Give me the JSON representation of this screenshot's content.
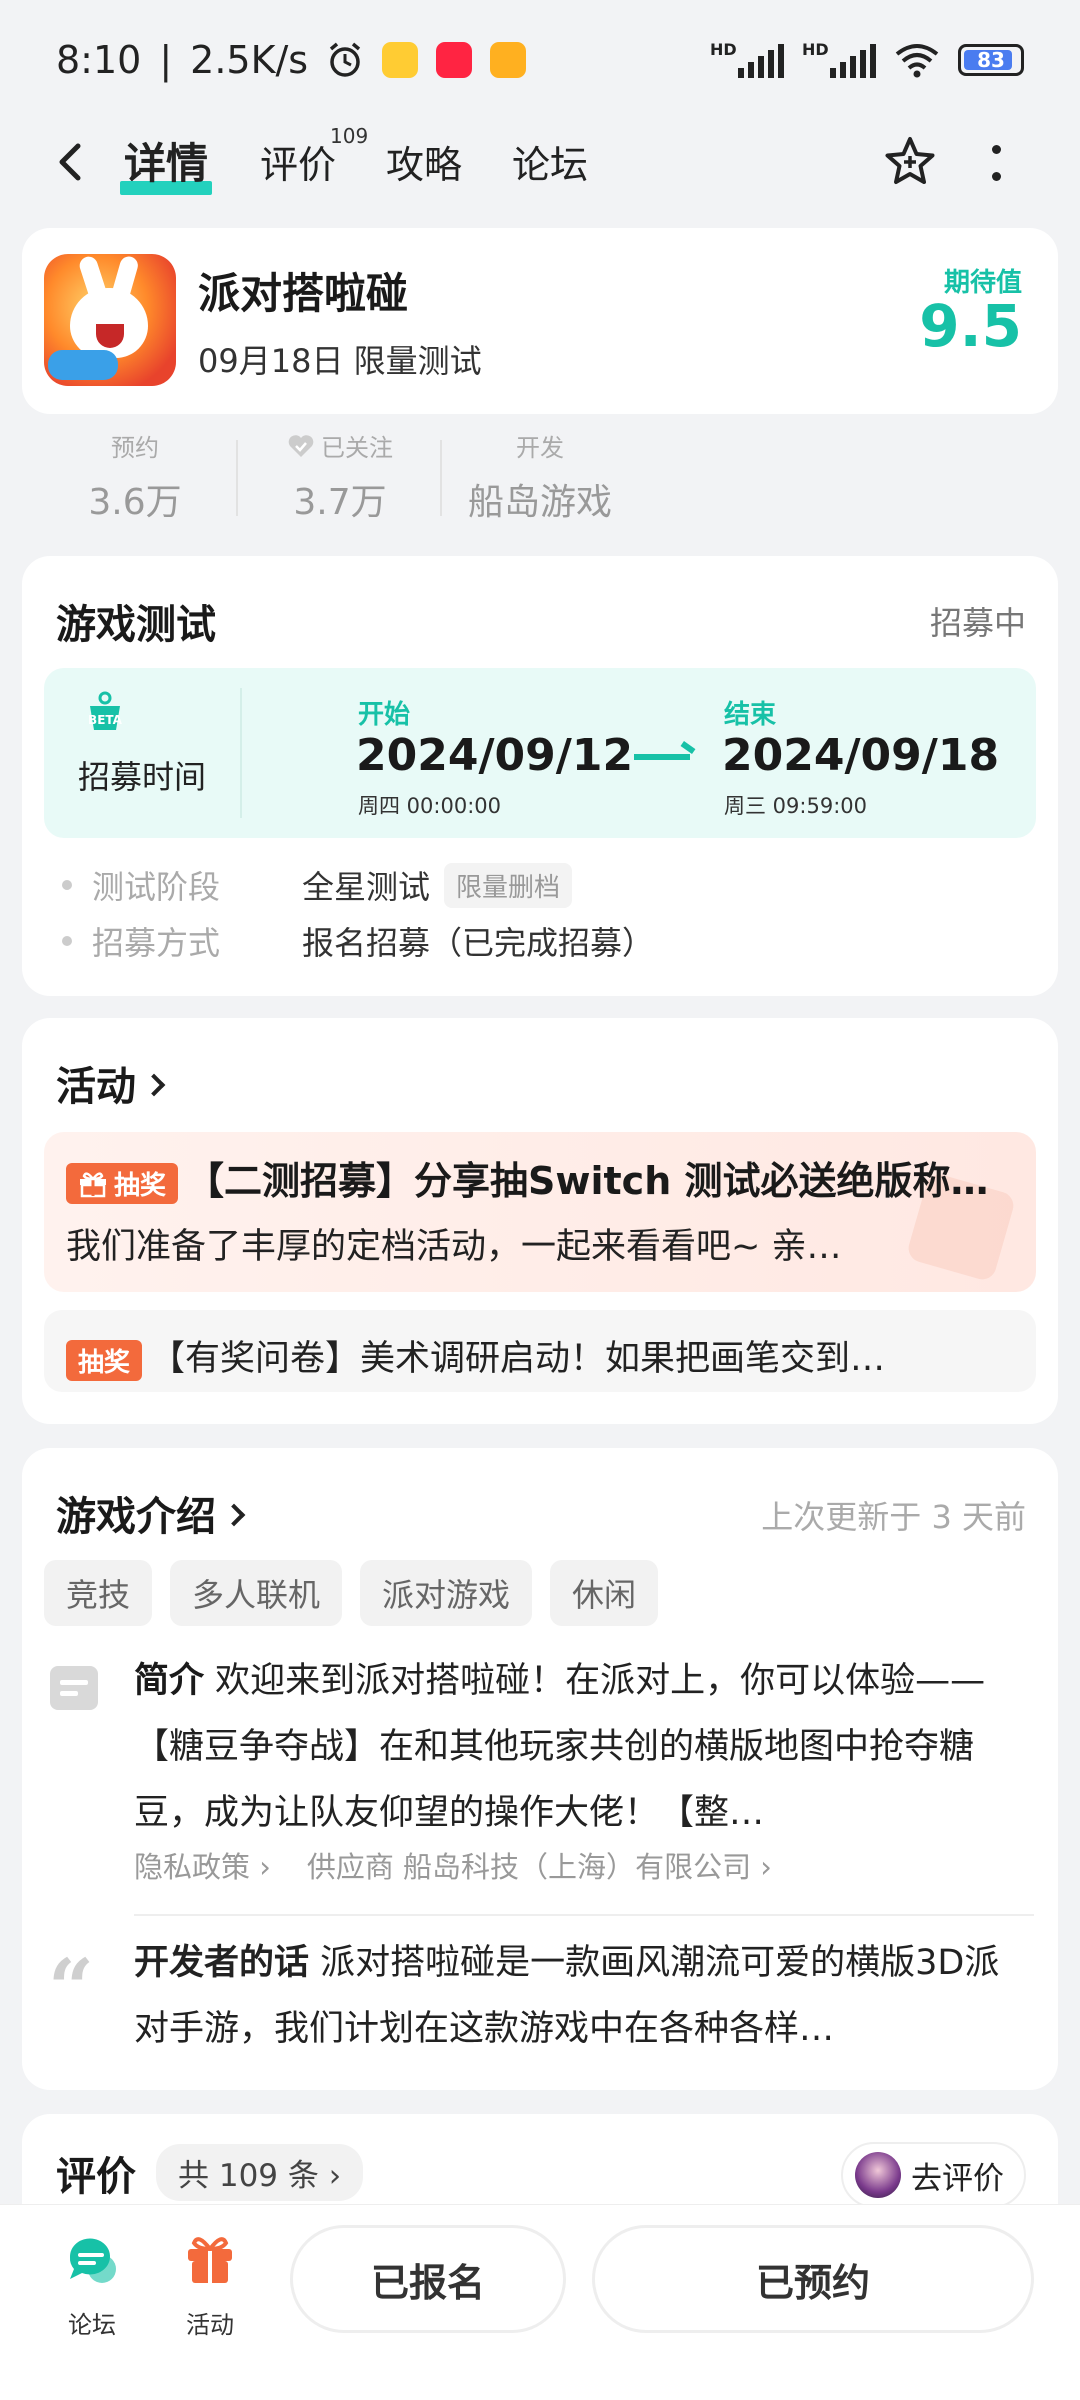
{
  "status": {
    "time": "8:10",
    "speed": "2.5K/s",
    "battery": "83",
    "hd": "HD"
  },
  "nav": {
    "tabs": [
      "详情",
      "评价",
      "攻略",
      "论坛"
    ],
    "review_count": "109"
  },
  "game": {
    "title": "派对搭啦碰",
    "subtitle": "09月18日 限量测试",
    "expect_label": "期待值",
    "expect_score": "9.5"
  },
  "stats": [
    {
      "label": "预约",
      "value": "3.6万"
    },
    {
      "label": "已关注",
      "value": "3.7万"
    },
    {
      "label": "开发",
      "value": "船岛游戏"
    }
  ],
  "test": {
    "title": "游戏测试",
    "status": "招募中",
    "badge": "BETA",
    "recruit_label": "招募时间",
    "start_label": "开始",
    "start_date": "2024/09/12",
    "start_sub": "周四  00:00:00",
    "end_label": "结束",
    "end_date": "2024/09/18",
    "end_sub": "周三  09:59:00",
    "rows": [
      {
        "k": "测试阶段",
        "v": "全星测试",
        "chip": "限量删档"
      },
      {
        "k": "招募方式",
        "v": "报名招募（已完成招募）"
      }
    ]
  },
  "activity": {
    "title": "活动",
    "badge": "抽奖",
    "item1_title": "【二测招募】分享抽Switch 测试必送绝版称…",
    "item1_desc": "我们准备了丰厚的定档活动，一起来看看吧~ 亲…",
    "item2_title": "【有奖问卷】美术调研启动！如果把画笔交到…"
  },
  "intro": {
    "title": "游戏介绍",
    "updated": "上次更新于 3 天前",
    "tags": [
      "竞技",
      "多人联机",
      "派对游戏",
      "休闲"
    ],
    "summary_label": "简介",
    "summary": "欢迎来到派对搭啦碰！在派对上，你可以体验——【糖豆争夺战】在和其他玩家共创的横版地图中抢夺糖豆，成为让队友仰望的操作大佬！【整…",
    "privacy": "隐私政策",
    "provider": "供应商 船岛科技（上海）有限公司",
    "dev_label": "开发者的话",
    "dev_text": "派对搭啦碰是一款画风潮流可爱的横版3D派对手游，我们计划在这款游戏中在各种各样…"
  },
  "review": {
    "title": "评价",
    "count": "共 109 条",
    "go": "去评价"
  },
  "bottom": {
    "forum": "论坛",
    "activity": "活动",
    "signed": "已报名",
    "reserved": "已预约"
  },
  "colors": {
    "accent": "#17c1a7",
    "lottery": "#f36a3c"
  }
}
